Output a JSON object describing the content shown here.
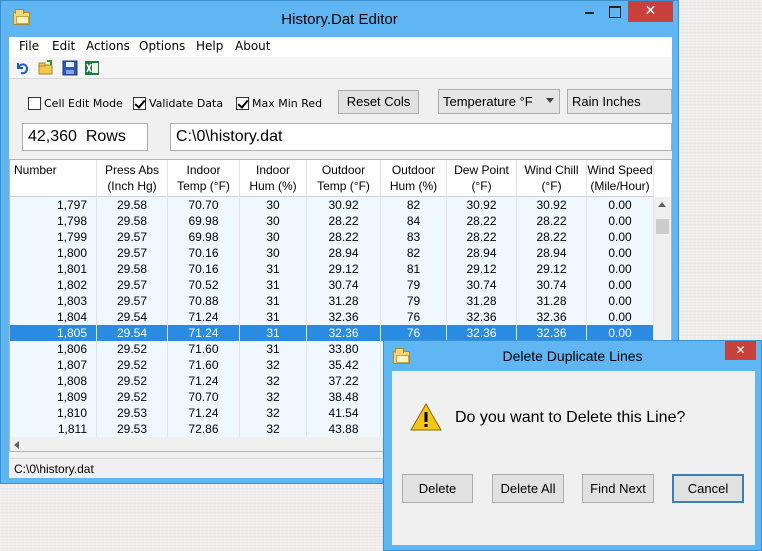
{
  "main_window": {
    "title": "History.Dat Editor",
    "menu": [
      "File",
      "Edit",
      "Actions",
      "Options",
      "Help",
      "About"
    ],
    "toolbar_icons": [
      "undo-icon",
      "open-folder-icon",
      "save-icon",
      "excel-icon"
    ],
    "options": {
      "cell_edit_mode": {
        "label": "Cell Edit Mode",
        "checked": false
      },
      "validate_data": {
        "label": "Validate Data",
        "checked": true
      },
      "max_min_red": {
        "label": "Max Min Red",
        "checked": true
      },
      "reset_cols_label": "Reset Cols",
      "temperature_unit": "Temperature °F",
      "rain_unit": "Rain Inches"
    },
    "row_count": "42,360  Rows",
    "file_path": "C:\\0\\history.dat",
    "status_text": "C:\\0\\history.dat"
  },
  "grid": {
    "columns": [
      {
        "line1": "Number",
        "line2": ""
      },
      {
        "line1": "Press Abs",
        "line2": "(Inch Hg)"
      },
      {
        "line1": "Indoor",
        "line2": "Temp (°F)"
      },
      {
        "line1": "Indoor",
        "line2": "Hum (%)"
      },
      {
        "line1": "Outdoor",
        "line2": "Temp (°F)"
      },
      {
        "line1": "Outdoor",
        "line2": "Hum (%)"
      },
      {
        "line1": "Dew Point",
        "line2": "(°F)"
      },
      {
        "line1": "Wind Chill",
        "line2": "(°F)"
      },
      {
        "line1": "Wind Speed",
        "line2": "(Mile/Hour)"
      }
    ],
    "selected_row_index": 8,
    "rows": [
      [
        "1,797",
        "29.58",
        "70.70",
        "30",
        "30.92",
        "82",
        "30.92",
        "30.92",
        "0.00"
      ],
      [
        "1,798",
        "29.58",
        "69.98",
        "30",
        "28.22",
        "84",
        "28.22",
        "28.22",
        "0.00"
      ],
      [
        "1,799",
        "29.57",
        "69.98",
        "30",
        "28.22",
        "83",
        "28.22",
        "28.22",
        "0.00"
      ],
      [
        "1,800",
        "29.57",
        "70.16",
        "30",
        "28.94",
        "82",
        "28.94",
        "28.94",
        "0.00"
      ],
      [
        "1,801",
        "29.58",
        "70.16",
        "31",
        "29.12",
        "81",
        "29.12",
        "29.12",
        "0.00"
      ],
      [
        "1,802",
        "29.57",
        "70.52",
        "31",
        "30.74",
        "79",
        "30.74",
        "30.74",
        "0.00"
      ],
      [
        "1,803",
        "29.57",
        "70.88",
        "31",
        "31.28",
        "79",
        "31.28",
        "31.28",
        "0.00"
      ],
      [
        "1,804",
        "29.54",
        "71.24",
        "31",
        "32.36",
        "76",
        "32.36",
        "32.36",
        "0.00"
      ],
      [
        "1,805",
        "29.54",
        "71.24",
        "31",
        "32.36",
        "76",
        "32.36",
        "32.36",
        "0.00"
      ],
      [
        "1,806",
        "29.52",
        "71.60",
        "31",
        "33.80",
        "",
        "",
        "",
        ""
      ],
      [
        "1,807",
        "29.52",
        "71.60",
        "32",
        "35.42",
        "",
        "",
        "",
        ""
      ],
      [
        "1,808",
        "29.52",
        "71.24",
        "32",
        "37.22",
        "",
        "",
        "",
        ""
      ],
      [
        "1,809",
        "29.52",
        "70.70",
        "32",
        "38.48",
        "",
        "",
        "",
        ""
      ],
      [
        "1,810",
        "29.53",
        "71.24",
        "32",
        "41.54",
        "",
        "",
        "",
        ""
      ],
      [
        "1,811",
        "29.53",
        "72.86",
        "32",
        "43.88",
        "",
        "",
        "",
        ""
      ]
    ]
  },
  "dialog": {
    "title": "Delete Duplicate Lines",
    "icon": "warning-icon",
    "message": "Do you want to Delete this Line?",
    "buttons": {
      "delete": "Delete",
      "delete_all": "Delete All",
      "find_next": "Find Next",
      "cancel": "Cancel"
    }
  },
  "colors": {
    "title_bar": "#5fb6f2",
    "close_button": "#c7403b",
    "selected_row": "#2a8be2",
    "row_background": "#f0f8ff"
  }
}
